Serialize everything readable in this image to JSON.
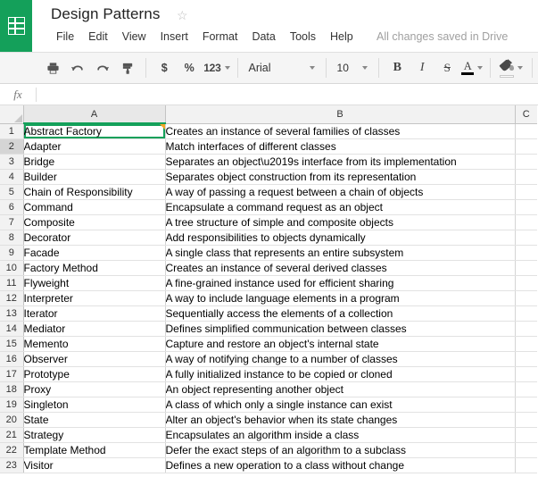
{
  "header": {
    "logo_icon": "sheets-grid-icon",
    "doc_title": "Design Patterns",
    "star_icon": "☆",
    "menus": [
      "File",
      "Edit",
      "View",
      "Insert",
      "Format",
      "Data",
      "Tools",
      "Help"
    ],
    "save_status": "All changes saved in Drive"
  },
  "toolbar": {
    "print_icon": "print-icon",
    "undo_icon": "undo-icon",
    "redo_icon": "redo-icon",
    "paint_format_icon": "paint-format-icon",
    "currency_label": "$",
    "percent_label": "%",
    "number_format_label": "123",
    "font_name": "Arial",
    "font_size": "10",
    "bold_label": "B",
    "italic_label": "I",
    "strikethrough_label": "S",
    "text_color_label": "A",
    "fill_color_icon": "paint-bucket-icon"
  },
  "formula_bar": {
    "fx_label": "fx",
    "value": "",
    "placeholder": ""
  },
  "grid": {
    "columns": [
      "A",
      "B",
      "C"
    ],
    "selected_cell": "A1",
    "selected_column": "A",
    "hovered_row": 2,
    "rows": [
      {
        "n": "1",
        "a": "Abstract Factory",
        "b": "Creates an instance of several families of classes"
      },
      {
        "n": "2",
        "a": "Adapter",
        "b": "Match interfaces of different classes"
      },
      {
        "n": "3",
        "a": "Bridge",
        "b": "Separates an object\\u2019s interface from its implementation"
      },
      {
        "n": "4",
        "a": "Builder",
        "b": "Separates object construction from its representation"
      },
      {
        "n": "5",
        "a": "Chain of Responsibility",
        "b": "A way of passing a request between a chain of objects"
      },
      {
        "n": "6",
        "a": "Command",
        "b": "Encapsulate a command request as an object"
      },
      {
        "n": "7",
        "a": "Composite",
        "b": "A tree structure of simple and composite objects"
      },
      {
        "n": "8",
        "a": "Decorator",
        "b": "Add responsibilities to objects dynamically"
      },
      {
        "n": "9",
        "a": "Facade",
        "b": "A single class that represents an entire subsystem"
      },
      {
        "n": "10",
        "a": "Factory Method",
        "b": "Creates an instance of several derived classes"
      },
      {
        "n": "11",
        "a": "Flyweight",
        "b": "A fine-grained instance used for efficient sharing"
      },
      {
        "n": "12",
        "a": "Interpreter",
        "b": "A way to include language elements in a program"
      },
      {
        "n": "13",
        "a": "Iterator",
        "b": "Sequentially access the elements of a collection"
      },
      {
        "n": "14",
        "a": "Mediator",
        "b": "Defines simplified communication between classes"
      },
      {
        "n": "15",
        "a": "Memento",
        "b": "Capture and restore an object's internal state"
      },
      {
        "n": "16",
        "a": "Observer",
        "b": "A way of notifying change to a number of classes"
      },
      {
        "n": "17",
        "a": "Prototype",
        "b": "A fully initialized instance to be copied or cloned"
      },
      {
        "n": "18",
        "a": "Proxy",
        "b": "An object representing another object"
      },
      {
        "n": "19",
        "a": "Singleton",
        "b": "A class of which only a single instance can exist"
      },
      {
        "n": "20",
        "a": "State",
        "b": "Alter an object's behavior when its state changes"
      },
      {
        "n": "21",
        "a": "Strategy",
        "b": "Encapsulates an algorithm inside a class"
      },
      {
        "n": "22",
        "a": "Template Method",
        "b": "Defer the exact steps of an algorithm to a subclass"
      },
      {
        "n": "23",
        "a": "Visitor",
        "b": "Defines a new operation to a class without change"
      }
    ]
  },
  "colors": {
    "brand_green": "#14a05a",
    "selection_green": "#14a05a",
    "note_flag_orange": "#f5a623",
    "toolbar_bg": "#f5f5f5",
    "header_bg": "#f2f2f2"
  }
}
